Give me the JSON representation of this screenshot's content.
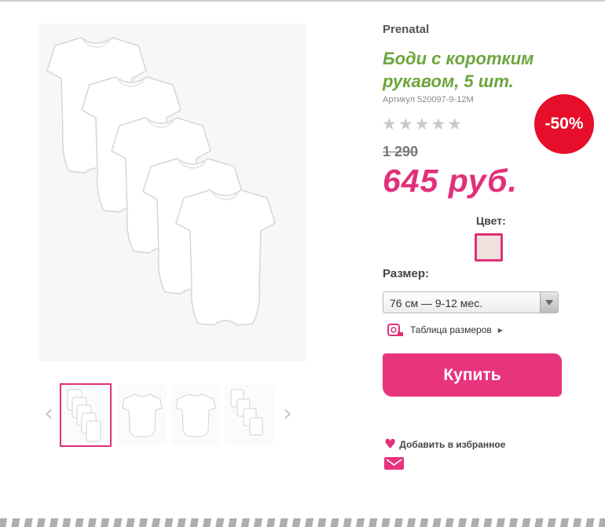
{
  "product": {
    "brand": "Prenatal",
    "title": "Боди с коротким рукавом, 5 шт.",
    "sku": "Артикул 520097-9-12M",
    "rating_stars": "★★★★★",
    "rating_value": 0,
    "discount_badge": "-50%",
    "old_price": "1 290",
    "price": "645 руб."
  },
  "options": {
    "color_label": "Цвет:",
    "color_swatch": "#efe1dd",
    "size_label": "Размер:",
    "size_value": "76 см — 9-12 мес.",
    "size_chart_link": "Таблица размеров"
  },
  "actions": {
    "buy_label": "Купить",
    "favorite_label": "Добавить в избранное"
  },
  "gallery": {
    "prev_icon": "‹",
    "next_icon": "›",
    "selected_index": 0
  },
  "colors": {
    "accent": "#e0307a",
    "title_green": "#6ba63c",
    "badge_red": "#e60e2a"
  }
}
